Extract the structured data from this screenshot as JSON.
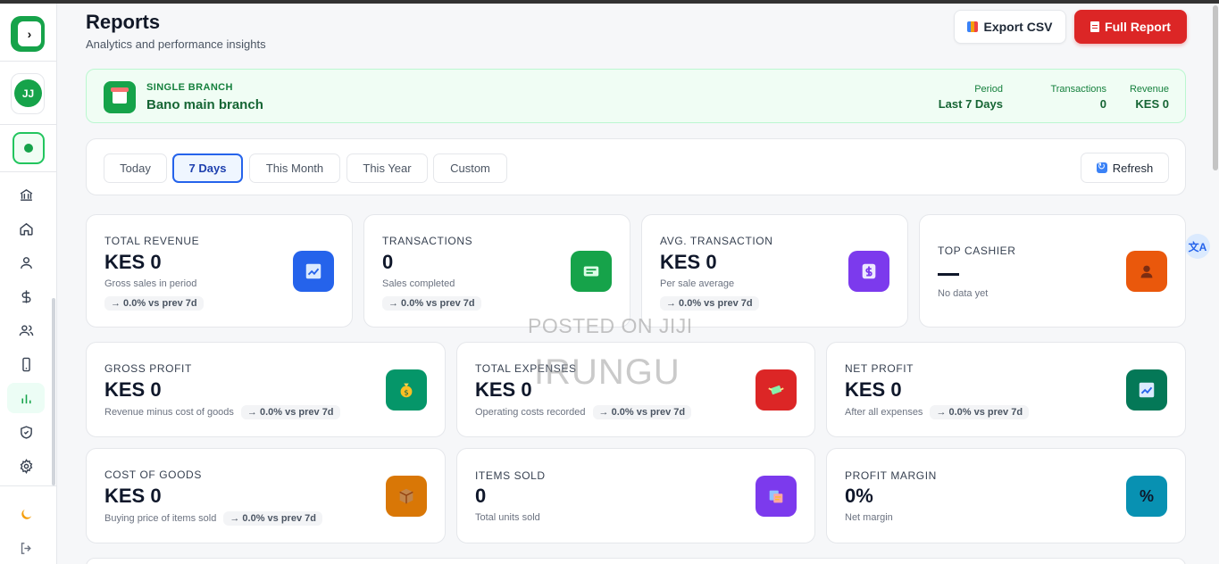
{
  "header": {
    "title": "Reports",
    "subtitle": "Analytics and performance insights",
    "export_label": "Export CSV",
    "full_report_label": "Full Report"
  },
  "sidebar": {
    "avatar_initials": "JJ",
    "items": [
      {
        "name": "bank-icon"
      },
      {
        "name": "home-icon"
      },
      {
        "name": "user-icon"
      },
      {
        "name": "dollar-icon"
      },
      {
        "name": "users-icon"
      },
      {
        "name": "mobile-icon"
      },
      {
        "name": "bar-chart-icon",
        "active": true
      },
      {
        "name": "shield-icon"
      },
      {
        "name": "gear-icon"
      }
    ],
    "bottom": [
      {
        "name": "moon-icon"
      },
      {
        "name": "logout-icon"
      }
    ]
  },
  "branch": {
    "tag": "SINGLE BRANCH",
    "name": "Bano main branch",
    "stats": [
      {
        "label": "Period",
        "value": "Last 7 Days"
      },
      {
        "label": "Transactions",
        "value": "0"
      },
      {
        "label": "Revenue",
        "value": "KES 0"
      }
    ]
  },
  "filters": {
    "options": [
      "Today",
      "7 Days",
      "This Month",
      "This Year",
      "Custom"
    ],
    "active": "7 Days",
    "refresh_label": "Refresh"
  },
  "cards_row1": [
    {
      "label": "TOTAL REVENUE",
      "value": "KES 0",
      "sub": "Gross sales in period",
      "trend": "→ 0.0% vs prev 7d",
      "color": "#2563eb",
      "icon": "trend-up-icon"
    },
    {
      "label": "TRANSACTIONS",
      "value": "0",
      "sub": "Sales completed",
      "trend": "→ 0.0% vs prev 7d",
      "color": "#16a34a",
      "icon": "receipt-icon"
    },
    {
      "label": "AVG. TRANSACTION",
      "value": "KES 0",
      "sub": "Per sale average",
      "trend": "→ 0.0% vs prev 7d",
      "color": "#7c3aed",
      "icon": "dollar-icon"
    },
    {
      "label": "TOP CASHIER",
      "value": "—",
      "sub": "No data yet",
      "color": "#ea580c",
      "icon": "person-icon"
    }
  ],
  "cards_row2": [
    {
      "label": "GROSS PROFIT",
      "value": "KES 0",
      "sub": "Revenue minus cost of goods",
      "trend": "→ 0.0% vs prev 7d",
      "color": "#059669",
      "icon": "money-bag-icon"
    },
    {
      "label": "TOTAL EXPENSES",
      "value": "KES 0",
      "sub": "Operating costs recorded",
      "trend": "→ 0.0% vs prev 7d",
      "color": "#dc2626",
      "icon": "money-wings-icon"
    },
    {
      "label": "NET PROFIT",
      "value": "KES 0",
      "sub": "After all expenses",
      "trend": "→ 0.0% vs prev 7d",
      "color": "#047857",
      "icon": "trend-up-icon"
    }
  ],
  "cards_row3": [
    {
      "label": "COST OF GOODS",
      "value": "KES 0",
      "sub": "Buying price of items sold",
      "trend": "→ 0.0% vs prev 7d",
      "color": "#d97706",
      "icon": "package-icon"
    },
    {
      "label": "ITEMS SOLD",
      "value": "0",
      "sub": "Total units sold",
      "color": "#7c3aed",
      "icon": "boxes-icon"
    },
    {
      "label": "PROFIT MARGIN",
      "value": "0%",
      "sub": "Net margin",
      "color": "#0891b2",
      "icon": "percent-icon",
      "icon_text": "%"
    }
  ],
  "watermark": {
    "line1": "POSTED ON JIJI",
    "line2": "IRUNGU"
  }
}
